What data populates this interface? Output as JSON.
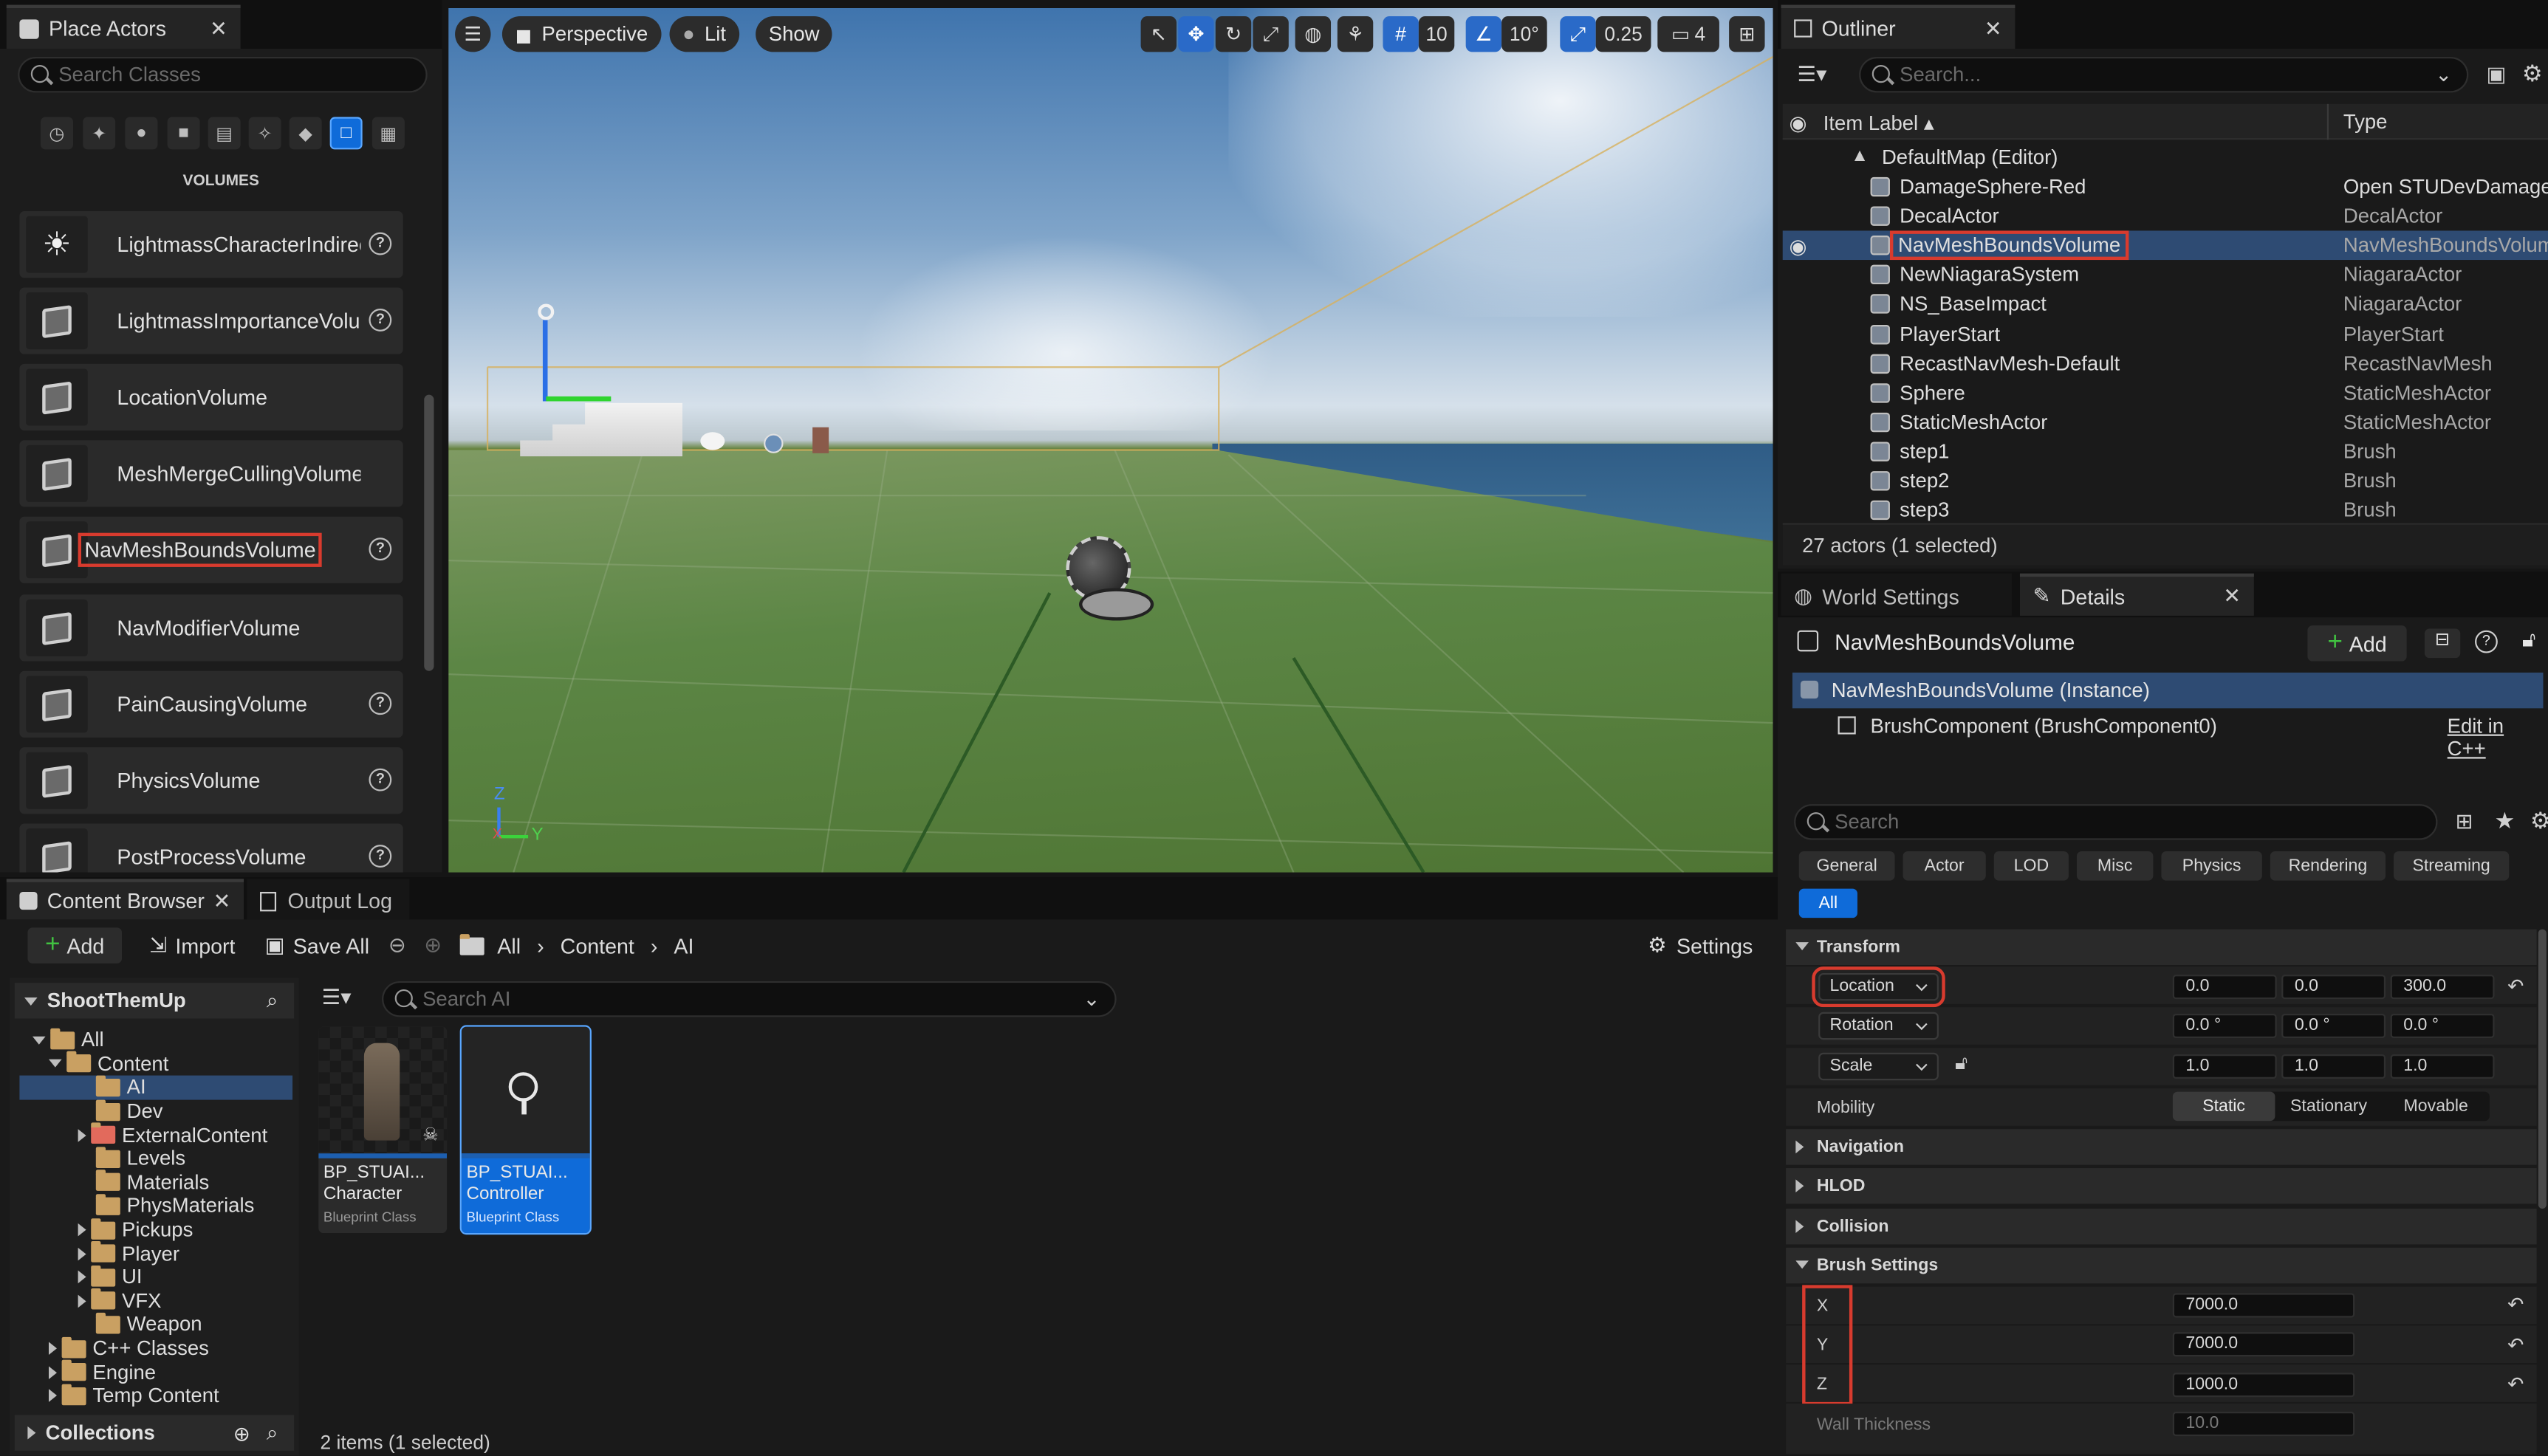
{
  "place_actors": {
    "tab_title": "Place Actors",
    "search_placeholder": "Search Classes",
    "section_label": "VOLUMES",
    "items": [
      {
        "label": "LightmassCharacterIndirec"
      },
      {
        "label": "LightmassImportanceVolur"
      },
      {
        "label": "LocationVolume"
      },
      {
        "label": "MeshMergeCullingVolume"
      },
      {
        "label": "NavMeshBoundsVolume"
      },
      {
        "label": "NavModifierVolume"
      },
      {
        "label": "PainCausingVolume"
      },
      {
        "label": "PhysicsVolume"
      },
      {
        "label": "PostProcessVolume"
      }
    ],
    "help_glyph": "?"
  },
  "viewport": {
    "perspective_label": "Perspective",
    "lit_label": "Lit",
    "show_label": "Show",
    "grid_size": "10",
    "rotation_snap": "10°",
    "scale_snap": "0.25",
    "camera_speed": "4",
    "axis_z": "Z",
    "axis_x": "X",
    "axis_y": "Y"
  },
  "content_browser": {
    "tab_title": "Content Browser",
    "output_log_tab": "Output Log",
    "add_label": "Add",
    "import_label": "Import",
    "save_all_label": "Save All",
    "breadcrumb": [
      "All",
      "Content",
      "AI"
    ],
    "settings_label": "Settings",
    "project_name": "ShootThemUp",
    "search_placeholder": "Search AI",
    "tree": [
      {
        "label": "All",
        "depth": 0,
        "expanded": true
      },
      {
        "label": "Content",
        "depth": 1,
        "expanded": true
      },
      {
        "label": "AI",
        "depth": 2,
        "selected": true
      },
      {
        "label": "Dev",
        "depth": 2
      },
      {
        "label": "ExternalContent",
        "depth": 2,
        "collapsed": true
      },
      {
        "label": "Levels",
        "depth": 2
      },
      {
        "label": "Materials",
        "depth": 2
      },
      {
        "label": "PhysMaterials",
        "depth": 2
      },
      {
        "label": "Pickups",
        "depth": 2,
        "collapsed": true
      },
      {
        "label": "Player",
        "depth": 2,
        "collapsed": true
      },
      {
        "label": "UI",
        "depth": 2,
        "collapsed": true
      },
      {
        "label": "VFX",
        "depth": 2,
        "collapsed": true
      },
      {
        "label": "Weapon",
        "depth": 2
      },
      {
        "label": "C++ Classes",
        "depth": 1,
        "collapsed": true
      },
      {
        "label": "Engine",
        "depth": 1,
        "collapsed": true
      },
      {
        "label": "Temp Content",
        "depth": 1,
        "collapsed": true
      }
    ],
    "collections_label": "Collections",
    "assets": [
      {
        "name1": "BP_STUAI...",
        "name2": "Character",
        "type": "Blueprint Class"
      },
      {
        "name1": "BP_STUAI...",
        "name2": "Controller",
        "type": "Blueprint Class",
        "selected": true
      }
    ],
    "status": "2 items (1 selected)"
  },
  "outliner": {
    "tab_title": "Outliner",
    "search_placeholder": "Search...",
    "col_label": "Item Label",
    "col_type": "Type",
    "map_row": "DefaultMap (Editor)",
    "rows": [
      {
        "name": "DamageSphere-Red",
        "type": "Open STUDevDamage"
      },
      {
        "name": "DecalActor",
        "type": "DecalActor"
      },
      {
        "name": "NavMeshBoundsVolume",
        "type": "NavMeshBoundsVolum"
      },
      {
        "name": "NewNiagaraSystem",
        "type": "NiagaraActor"
      },
      {
        "name": "NS_BaseImpact",
        "type": "NiagaraActor"
      },
      {
        "name": "PlayerStart",
        "type": "PlayerStart"
      },
      {
        "name": "RecastNavMesh-Default",
        "type": "RecastNavMesh"
      },
      {
        "name": "Sphere",
        "type": "StaticMeshActor"
      },
      {
        "name": "StaticMeshActor",
        "type": "StaticMeshActor"
      },
      {
        "name": "step1",
        "type": "Brush"
      },
      {
        "name": "step2",
        "type": "Brush"
      },
      {
        "name": "step3",
        "type": "Brush"
      }
    ],
    "count": "27 actors (1 selected)"
  },
  "details": {
    "world_settings_tab": "World Settings",
    "details_tab": "Details",
    "actor_name": "NavMeshBoundsVolume",
    "add_label": "Add",
    "instance_row": "NavMeshBoundsVolume (Instance)",
    "component_row": "BrushComponent (BrushComponent0)",
    "edit_cpp": "Edit in C++",
    "search_placeholder": "Search",
    "categories": [
      "General",
      "Actor",
      "LOD",
      "Misc",
      "Physics",
      "Rendering",
      "Streaming",
      "All"
    ],
    "transform_label": "Transform",
    "location_label": "Location",
    "location": [
      "0.0",
      "0.0",
      "300.0"
    ],
    "rotation_label": "Rotation",
    "rotation": [
      "0.0 °",
      "0.0 °",
      "0.0 °"
    ],
    "scale_label": "Scale",
    "scale": [
      "1.0",
      "1.0",
      "1.0"
    ],
    "mobility_label": "Mobility",
    "mobility_options": [
      "Static",
      "Stationary",
      "Movable"
    ],
    "sections": [
      "Navigation",
      "HLOD",
      "Collision"
    ],
    "brush_settings_label": "Brush Settings",
    "brush_x_label": "X",
    "brush_x": "7000.0",
    "brush_y_label": "Y",
    "brush_y": "7000.0",
    "brush_z_label": "Z",
    "brush_z": "1000.0",
    "wall_thickness_label": "Wall Thickness",
    "wall_thickness": "10.0"
  },
  "colors": {
    "accent": "#0f6bd9",
    "highlight_box": "#d83b2e",
    "selection": "#2e4b73"
  }
}
